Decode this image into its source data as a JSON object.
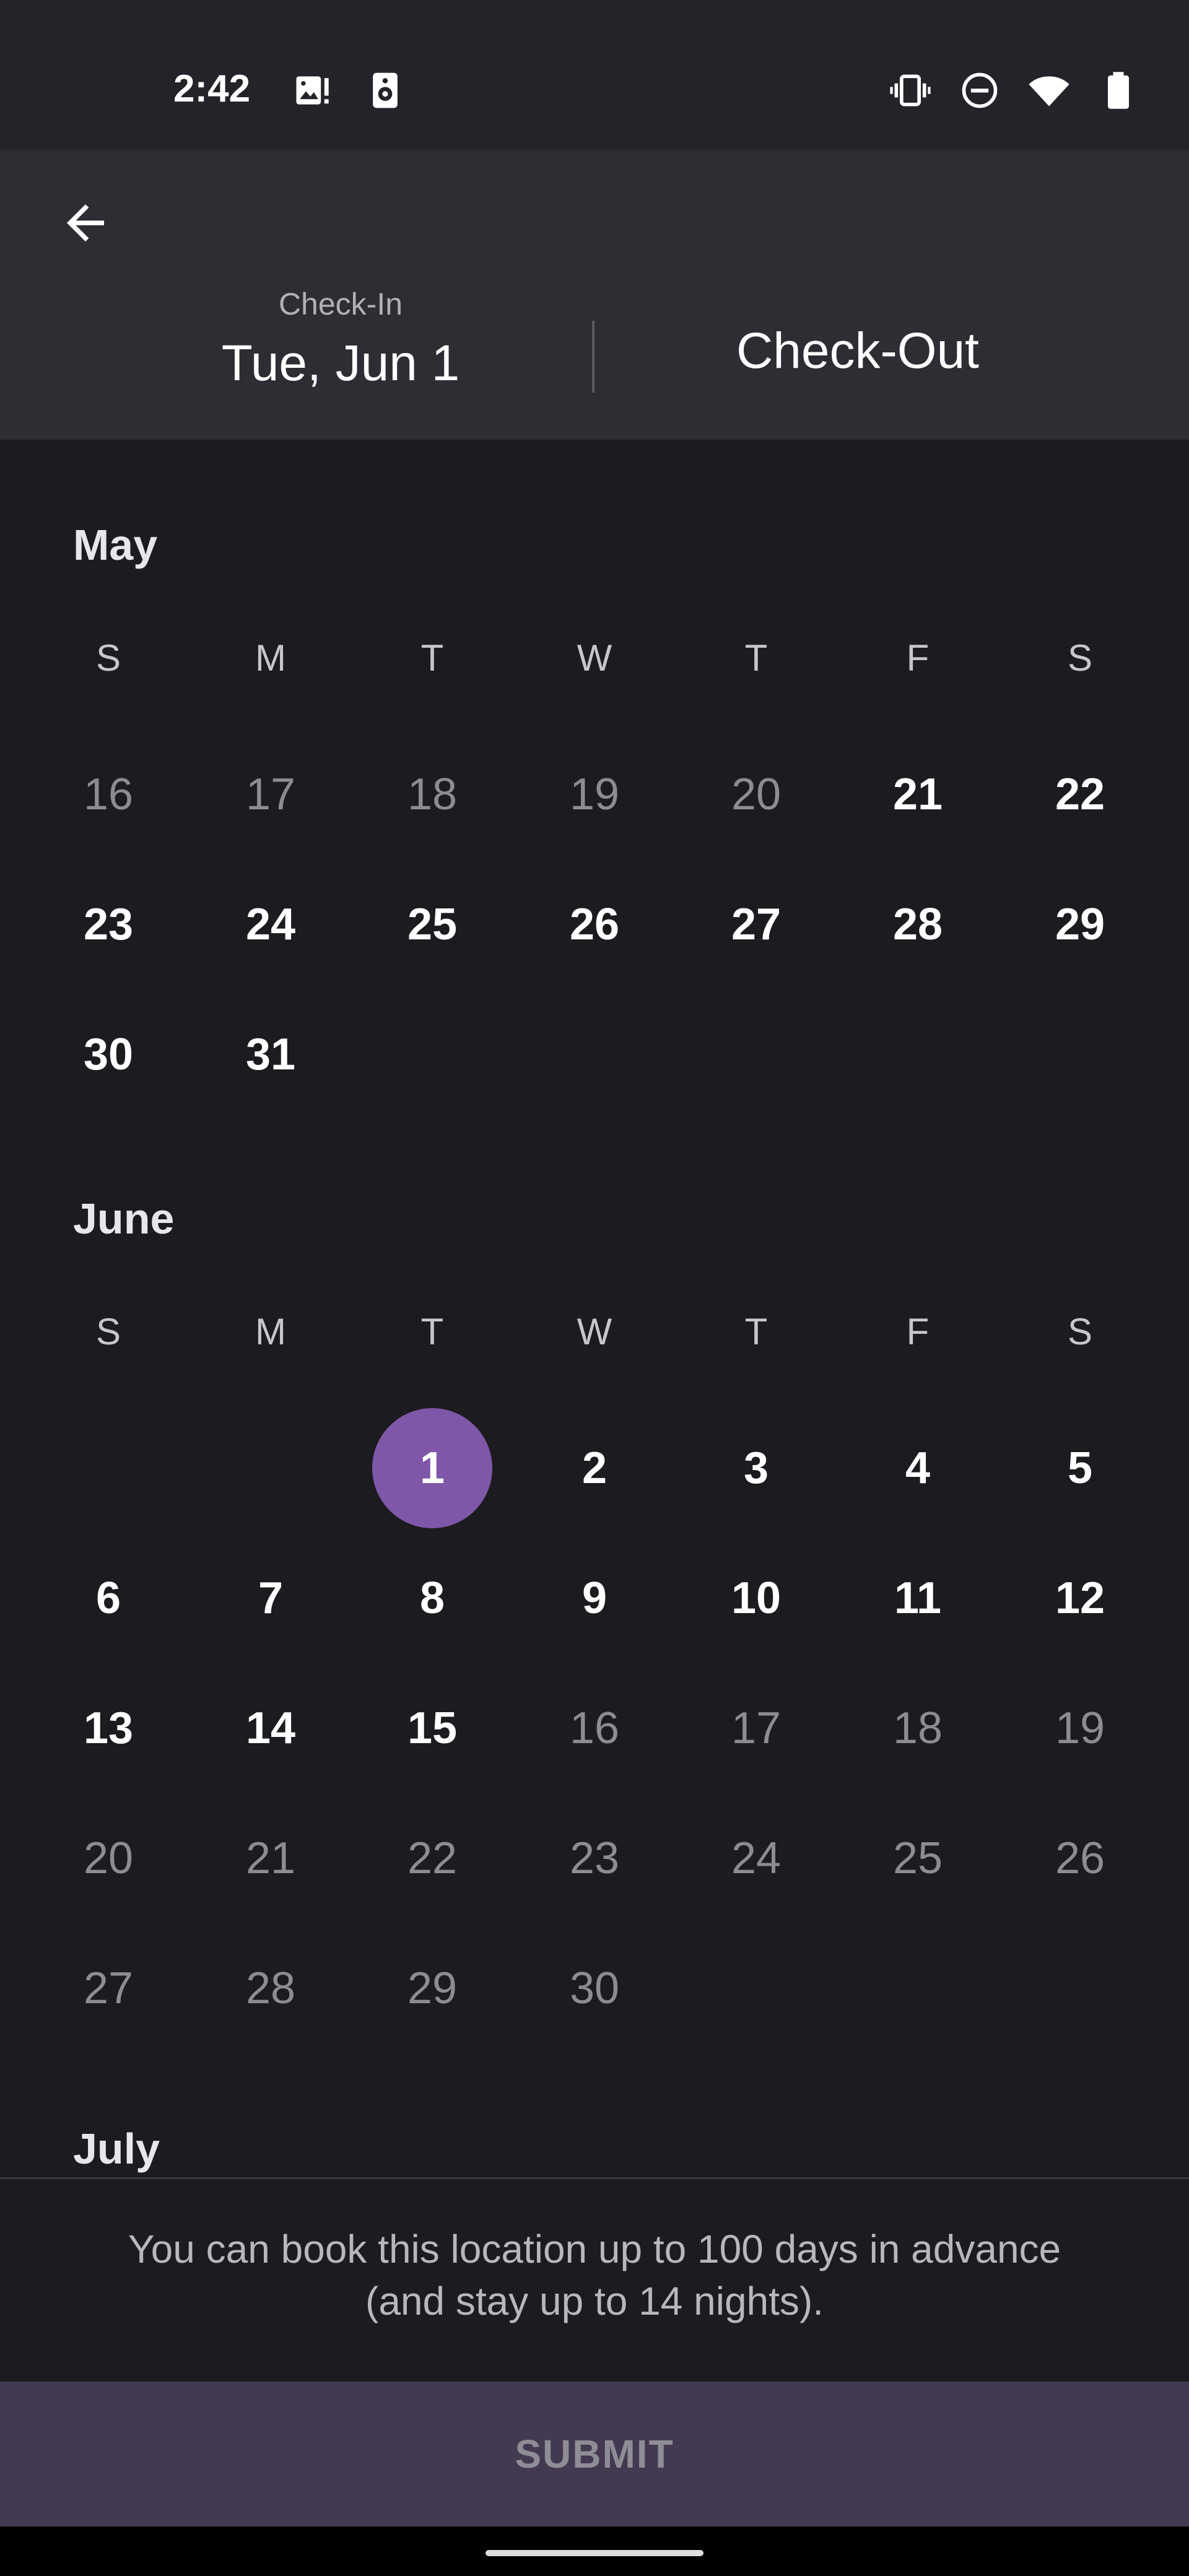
{
  "status_bar": {
    "time": "2:42",
    "left_icons": [
      "image-alert-icon",
      "speaker-icon"
    ],
    "right_icons": [
      "vibrate-icon",
      "do-not-disturb-icon",
      "wifi-icon",
      "battery-icon"
    ]
  },
  "header": {
    "back_icon": "arrow-back-icon",
    "checkin_label": "Check-In",
    "checkin_date": "Tue, Jun 1",
    "checkout_label": "Check-Out"
  },
  "calendar": {
    "weekdays": [
      "S",
      "M",
      "T",
      "W",
      "T",
      "F",
      "S"
    ],
    "months": [
      {
        "name": "May",
        "days": [
          {
            "d": "16",
            "active": false
          },
          {
            "d": "17",
            "active": false
          },
          {
            "d": "18",
            "active": false
          },
          {
            "d": "19",
            "active": false
          },
          {
            "d": "20",
            "active": false
          },
          {
            "d": "21",
            "active": true
          },
          {
            "d": "22",
            "active": true
          },
          {
            "d": "23",
            "active": true
          },
          {
            "d": "24",
            "active": true
          },
          {
            "d": "25",
            "active": true
          },
          {
            "d": "26",
            "active": true
          },
          {
            "d": "27",
            "active": true
          },
          {
            "d": "28",
            "active": true
          },
          {
            "d": "29",
            "active": true
          },
          {
            "d": "30",
            "active": true
          },
          {
            "d": "31",
            "active": true
          }
        ]
      },
      {
        "name": "June",
        "days": [
          {
            "d": "1",
            "active": true,
            "selected": true
          },
          {
            "d": "2",
            "active": true
          },
          {
            "d": "3",
            "active": true
          },
          {
            "d": "4",
            "active": true
          },
          {
            "d": "5",
            "active": true
          },
          {
            "d": "6",
            "active": true
          },
          {
            "d": "7",
            "active": true
          },
          {
            "d": "8",
            "active": true
          },
          {
            "d": "9",
            "active": true
          },
          {
            "d": "10",
            "active": true
          },
          {
            "d": "11",
            "active": true
          },
          {
            "d": "12",
            "active": true
          },
          {
            "d": "13",
            "active": true
          },
          {
            "d": "14",
            "active": true
          },
          {
            "d": "15",
            "active": true
          },
          {
            "d": "16",
            "active": false
          },
          {
            "d": "17",
            "active": false
          },
          {
            "d": "18",
            "active": false
          },
          {
            "d": "19",
            "active": false
          },
          {
            "d": "20",
            "active": false
          },
          {
            "d": "21",
            "active": false
          },
          {
            "d": "22",
            "active": false
          },
          {
            "d": "23",
            "active": false
          },
          {
            "d": "24",
            "active": false
          },
          {
            "d": "25",
            "active": false
          },
          {
            "d": "26",
            "active": false
          },
          {
            "d": "27",
            "active": false
          },
          {
            "d": "28",
            "active": false
          },
          {
            "d": "29",
            "active": false
          },
          {
            "d": "30",
            "active": false
          }
        ]
      },
      {
        "name": "July",
        "days": []
      }
    ]
  },
  "footer": {
    "info_text": "You can book this location up to 100 days in advance (and stay up to 14 nights).",
    "submit_label": "SUBMIT"
  },
  "colors": {
    "background": "#1c1b1f",
    "header": "#2e2d33",
    "selected": "#7e57a8",
    "submit_bg": "#433a52"
  }
}
